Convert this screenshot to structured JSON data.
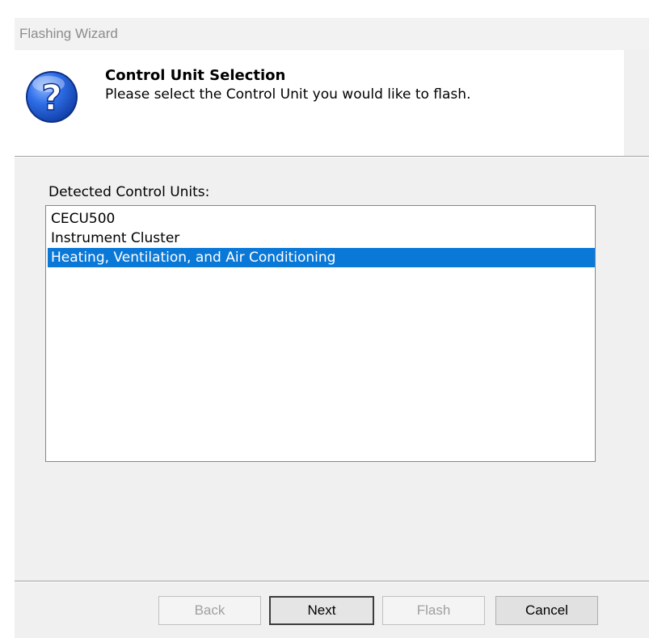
{
  "window": {
    "title": "Flashing Wizard"
  },
  "header": {
    "title": "Control Unit Selection",
    "subtitle": "Please select the Control Unit you would like to flash.",
    "icon": "help-question-icon"
  },
  "list": {
    "label": "Detected Control Units:",
    "items": [
      {
        "label": "CECU500",
        "selected": false
      },
      {
        "label": "Instrument Cluster",
        "selected": false
      },
      {
        "label": "Heating, Ventilation, and Air Conditioning",
        "selected": true
      }
    ]
  },
  "buttons": {
    "back": {
      "label": "Back",
      "enabled": false
    },
    "next": {
      "label": "Next",
      "enabled": true
    },
    "flash": {
      "label": "Flash",
      "enabled": false
    },
    "cancel": {
      "label": "Cancel",
      "enabled": true
    }
  },
  "colors": {
    "selection": "#0a78d7",
    "icon_blue": "#1f5fd6"
  }
}
